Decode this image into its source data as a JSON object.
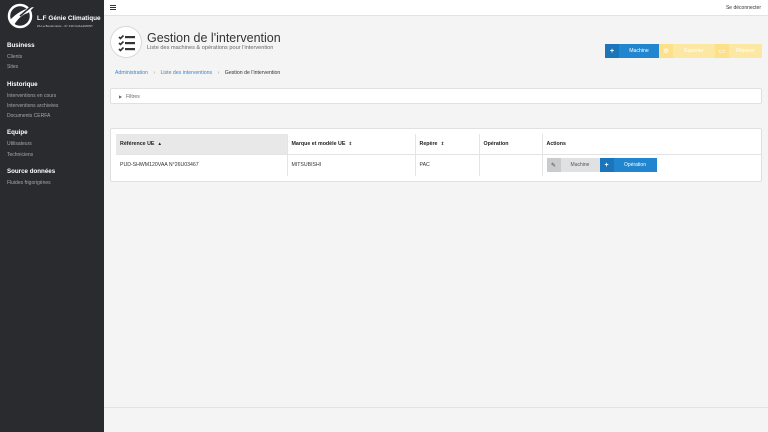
{
  "brand": {
    "name": "L.F Génie Climatique",
    "subtitle": "ZA La Boulonnière - 07 130 CHALAMONT"
  },
  "sidebar": {
    "sections": [
      {
        "title": "Business",
        "items": [
          "Clients",
          "Sites"
        ]
      },
      {
        "title": "Historique",
        "items": [
          "Interventions en cours",
          "Interventions archivées",
          "Documents CERFA"
        ]
      },
      {
        "title": "Equipe",
        "items": [
          "Utilisateurs",
          "Techniciens"
        ]
      },
      {
        "title": "Source données",
        "items": [
          "Fluides frigorigènes"
        ]
      }
    ]
  },
  "topbar": {
    "menu_icon": "hamburger-icon",
    "logout_label": "Se déconnecter"
  },
  "header": {
    "icon": "checklist-icon",
    "title": "Gestion de l'intervention",
    "subtitle": "Liste des machines & opérations pour l'intervention"
  },
  "toolbar": {
    "machine_label": "Machine",
    "export_label": "Exporter",
    "repair_label": "Réparer"
  },
  "breadcrumb": {
    "items": [
      "Administration",
      "Liste des interventions",
      "Gestion de l'intervention"
    ]
  },
  "filters": {
    "label": "Filtres"
  },
  "table": {
    "columns": [
      "Référence UE",
      "Marque et modèle UE",
      "Repère",
      "Opération",
      "Actions"
    ],
    "sorted_column": "Référence UE",
    "rows": [
      {
        "reference": "PUD-SHWM120VAA N°26U03467",
        "brand_model": "MITSUBISHI",
        "repere": "PAC",
        "operation": "",
        "actions": {
          "machine_label": "Machine",
          "operation_label": "Opération"
        }
      }
    ]
  },
  "colors": {
    "primary": "#2185d0",
    "warning": "#fde8a3",
    "sidebar": "#2a2b2e"
  }
}
